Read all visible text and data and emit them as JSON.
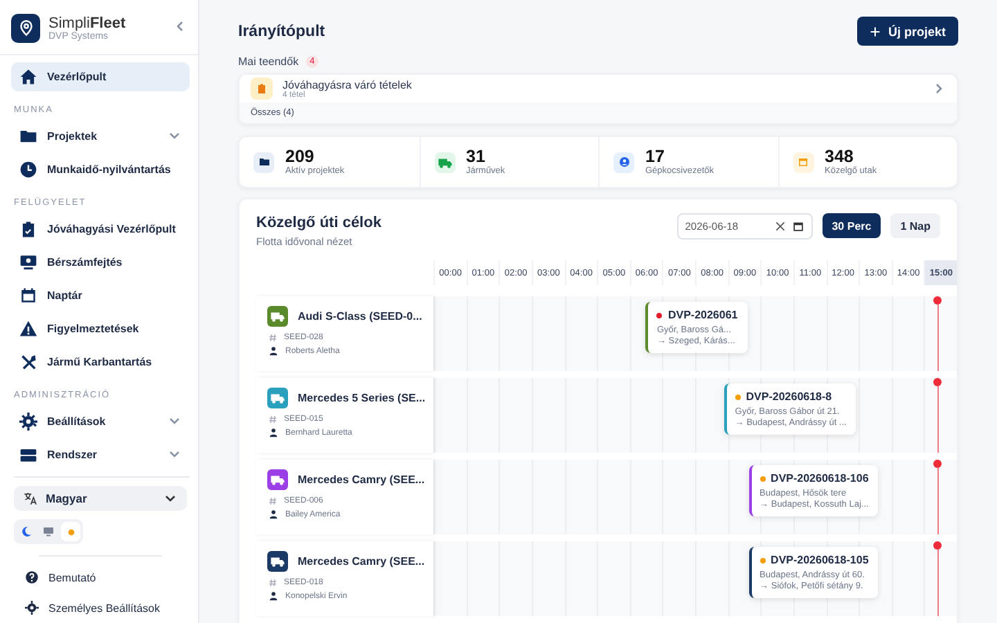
{
  "sidebar": {
    "brand": {
      "name": "Simpli**Fleet**",
      "subtitle": "DVP Systems"
    },
    "top_items": [
      {
        "label": "Vezérlőpult",
        "selected": true,
        "expandable": false
      }
    ],
    "sections": [
      {
        "title": "MUNKA",
        "items": [
          {
            "label": "Projektek",
            "selected": false,
            "expandable": true
          },
          {
            "label": "Munkaidő-nyilvántartás",
            "selected": false,
            "expandable": false
          }
        ]
      },
      {
        "title": "FELÜGYELET",
        "items": [
          {
            "label": "Jóváhagyási Vezérlőpult",
            "selected": false,
            "expandable": false
          },
          {
            "label": "Bérszámfejtés",
            "selected": false,
            "expandable": false
          },
          {
            "label": "Naptár",
            "selected": false,
            "expandable": false
          },
          {
            "label": "Figyelmeztetések",
            "selected": false,
            "expandable": false
          },
          {
            "label": "Jármű Karbantartás",
            "selected": false,
            "expandable": false
          }
        ]
      },
      {
        "title": "ADMINISZTRÁCIÓ",
        "items": [
          {
            "label": "Beállítások",
            "selected": false,
            "expandable": true
          },
          {
            "label": "Rendszer",
            "selected": false,
            "expandable": true
          }
        ]
      }
    ],
    "language": "Magyar",
    "theme_options": [
      {
        "selected": false
      },
      {
        "selected": false
      },
      {
        "selected": true
      }
    ],
    "footer_items": [
      {
        "label": "Bemutató"
      },
      {
        "label": "Személyes Beállítások"
      }
    ]
  },
  "main": {
    "title": "Irányítópult",
    "new_button": "Új projekt",
    "todo": {
      "label": "Mai teendők",
      "count": "4",
      "items": [
        {
          "title": "Jóváhagyásra váró tételek",
          "subtitle": "4 tétel"
        }
      ],
      "footer": "Összes (4)"
    },
    "stats": [
      {
        "value": "209",
        "label": "Aktív projektek"
      },
      {
        "value": "31",
        "label": "Járművek"
      },
      {
        "value": "17",
        "label": "Gépkocsivezetők"
      },
      {
        "value": "348",
        "label": "Közelgő utak"
      }
    ],
    "timeline": {
      "title": "Közelgő úti célok",
      "subtitle": "Flotta idővonal nézet",
      "date": "2026-06-18",
      "zoom_options": [
        {
          "label": "30 Perc",
          "selected": true
        },
        {
          "label": "1 Nap",
          "selected": false
        }
      ],
      "hours": [
        {
          "label": "00:00",
          "current": false
        },
        {
          "label": "01:00",
          "current": false
        },
        {
          "label": "02:00",
          "current": false
        },
        {
          "label": "03:00",
          "current": false
        },
        {
          "label": "04:00",
          "current": false
        },
        {
          "label": "05:00",
          "current": false
        },
        {
          "label": "06:00",
          "current": false
        },
        {
          "label": "07:00",
          "current": false
        },
        {
          "label": "08:00",
          "current": false
        },
        {
          "label": "09:00",
          "current": false
        },
        {
          "label": "10:00",
          "current": false
        },
        {
          "label": "11:00",
          "current": false
        },
        {
          "label": "12:00",
          "current": false
        },
        {
          "label": "13:00",
          "current": false
        },
        {
          "label": "14:00",
          "current": false
        },
        {
          "label": "15:00",
          "current": true
        }
      ],
      "rows": [
        {
          "vehicle": "Audi S-Class (SEED-0...",
          "plate": "SEED-028",
          "driver": "Roberts Aletha",
          "color": "#5b8a2c",
          "trips": [
            {
              "code": "DVP-2026061",
              "color": "#e11d2e",
              "from": "Győr, Baross Gá...",
              "to": "→ Szeged, Kárás..."
            }
          ]
        },
        {
          "vehicle": "Mercedes 5 Series (SE...",
          "plate": "SEED-015",
          "driver": "Bernhard Lauretta",
          "color": "#2aa0bd",
          "trips": [
            {
              "code": "DVP-20260618-8",
              "color": "#f59e0b",
              "from": "Győr, Baross Gábor út 21.",
              "to": "→ Budapest, Andrássy út ..."
            }
          ]
        },
        {
          "vehicle": "Mercedes Camry (SEE...",
          "plate": "SEED-006",
          "driver": "Bailey America",
          "color": "#9b3fe6",
          "trips": [
            {
              "code": "DVP-20260618-106",
              "color": "#f59e0b",
              "from": "Budapest, Hősök tere",
              "to": "→ Budapest, Kossuth Laj..."
            }
          ]
        },
        {
          "vehicle": "Mercedes Camry (SEE...",
          "plate": "SEED-018",
          "driver": "Konopelski Ervin",
          "color": "#1b3a66",
          "trips": [
            {
              "code": "DVP-20260618-105",
              "color": "#f59e0b",
              "from": "Budapest, Andrássy út 60.",
              "to": "→ Siófok, Petőfi sétány 9."
            }
          ]
        }
      ]
    }
  }
}
